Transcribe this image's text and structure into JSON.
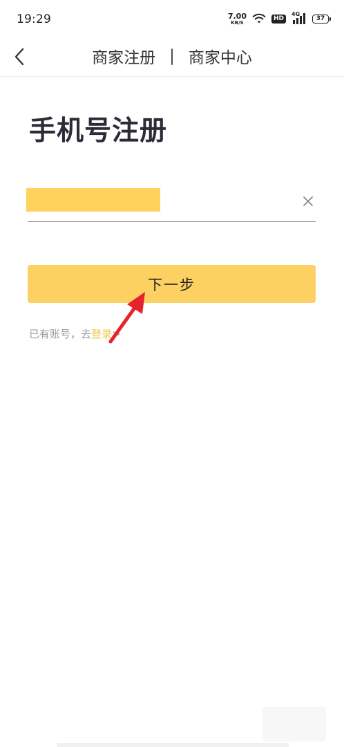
{
  "status_bar": {
    "time": "19:29",
    "speed_value": "7.00",
    "speed_unit": "KB/S",
    "hd_label": "HD",
    "network_label": "4G",
    "battery_level": "37"
  },
  "nav": {
    "title_left": "商家注册",
    "separator": "|",
    "title_right": "商家中心"
  },
  "page": {
    "heading": "手机号注册",
    "phone_placeholder": "",
    "next_label": "下一步",
    "login_prompt": "已有账号，去",
    "login_link": "登录",
    "login_chevron": ">"
  },
  "colors": {
    "accent": "#fdd062",
    "link": "#f5c545",
    "annotation": "#e5232b"
  }
}
